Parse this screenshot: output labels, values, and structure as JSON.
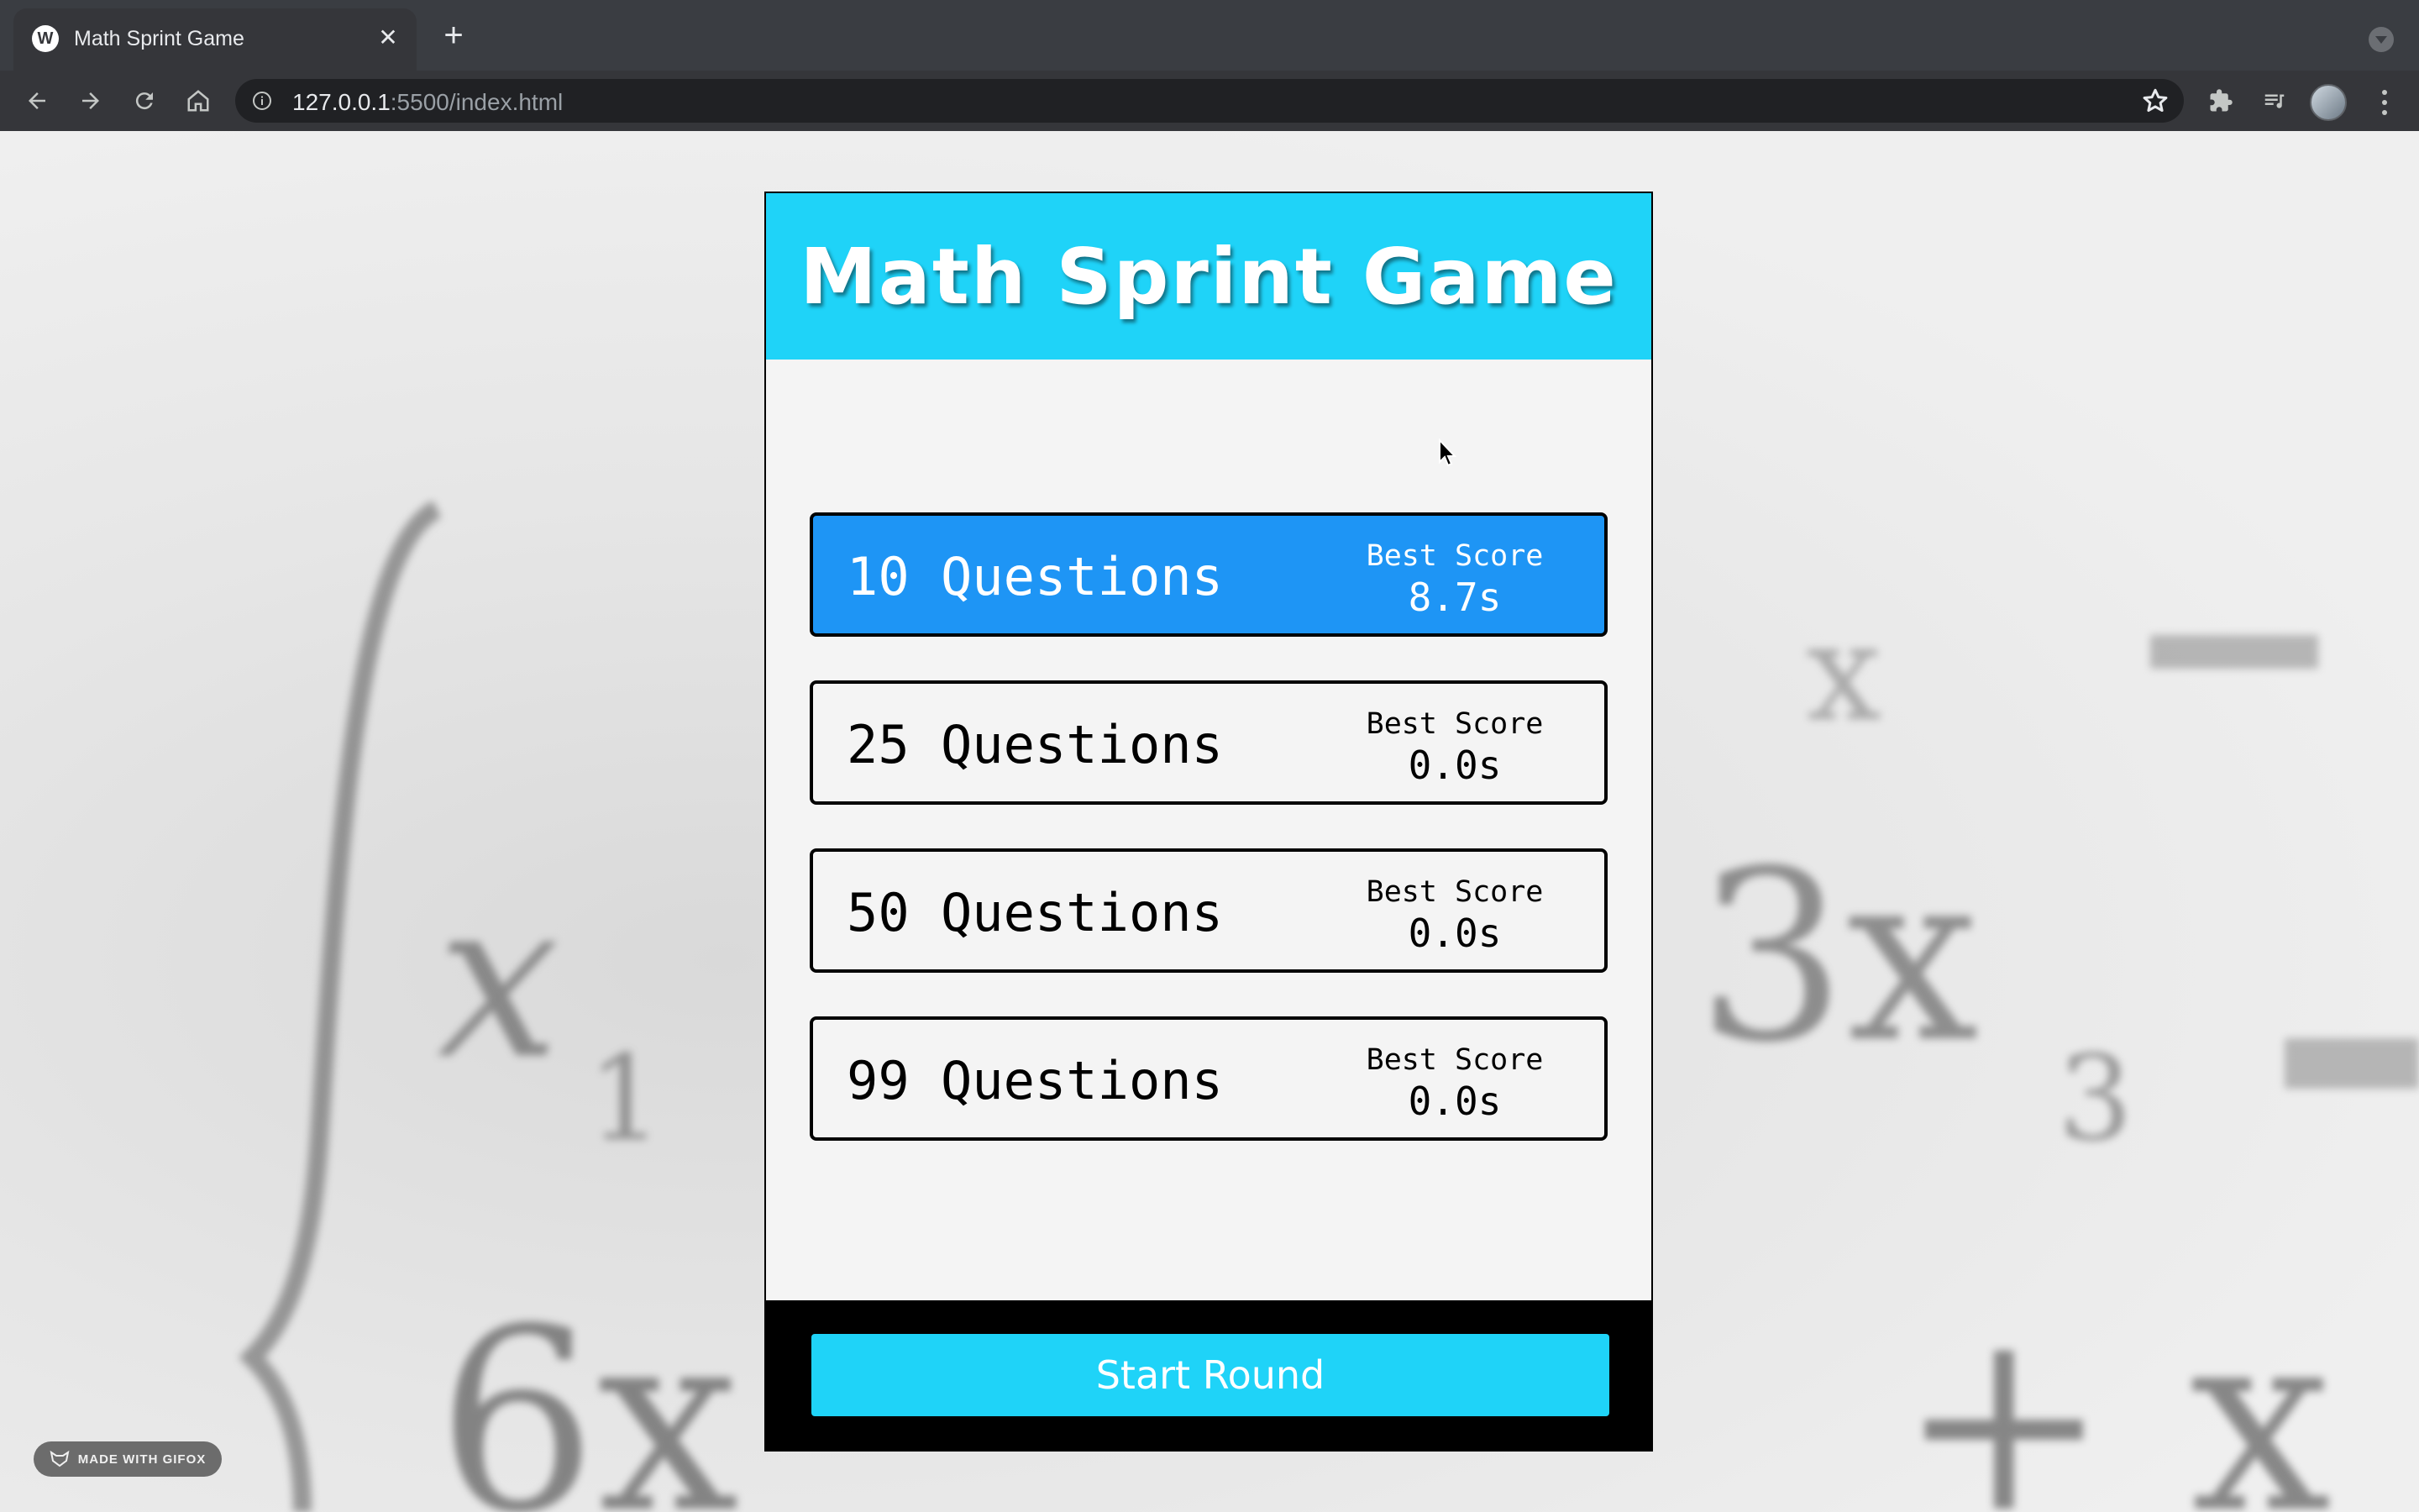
{
  "browser": {
    "tab_title": "Math Sprint Game",
    "tab_favicon_letter": "W",
    "url_host": "127.0.0.1",
    "url_rest": ":5500/index.html",
    "icons": [
      "back-icon",
      "forward-icon",
      "reload-icon",
      "home-icon",
      "info-icon",
      "star-icon",
      "extensions-icon",
      "media-icon",
      "profile-avatar",
      "menu-icon"
    ]
  },
  "game": {
    "title": "Math Sprint Game",
    "options": [
      {
        "label": "10 Questions",
        "score_label": "Best Score",
        "score": "8.7s",
        "selected": true
      },
      {
        "label": "25 Questions",
        "score_label": "Best Score",
        "score": "0.0s",
        "selected": false
      },
      {
        "label": "50 Questions",
        "score_label": "Best Score",
        "score": "0.0s",
        "selected": false
      },
      {
        "label": "99 Questions",
        "score_label": "Best Score",
        "score": "0.0s",
        "selected": false
      }
    ],
    "start_label": "Start Round",
    "colors": {
      "header": "#1fd3f8",
      "selected": "#1e95f5",
      "footer": "#000000"
    }
  },
  "watermark": {
    "label": "MADE WITH GIFOX"
  }
}
